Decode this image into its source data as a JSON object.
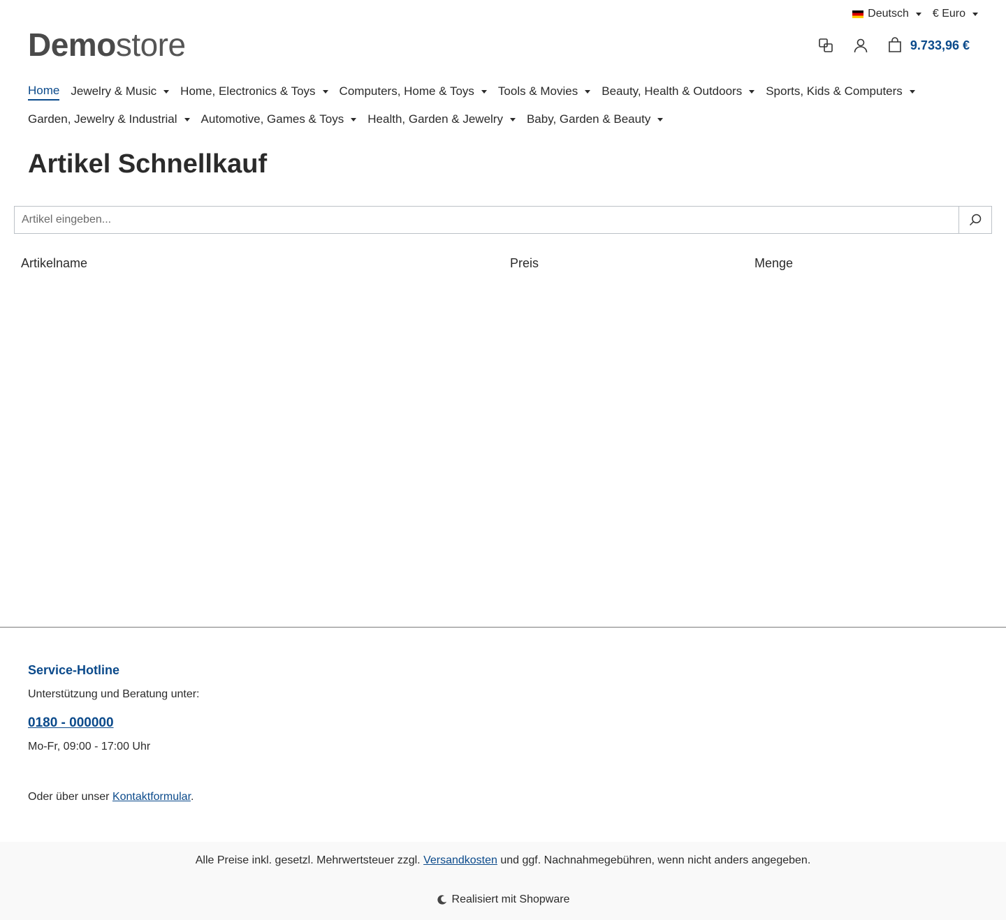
{
  "topbar": {
    "language": "Deutsch",
    "currency": "€ Euro"
  },
  "logo": {
    "bold": "Demo",
    "light": "store"
  },
  "header": {
    "cart_total": "9.733,96 €"
  },
  "nav": {
    "items": [
      {
        "label": "Home"
      },
      {
        "label": "Jewelry & Music"
      },
      {
        "label": "Home, Electronics & Toys"
      },
      {
        "label": "Computers, Home & Toys"
      },
      {
        "label": "Tools & Movies"
      },
      {
        "label": "Beauty, Health & Outdoors"
      },
      {
        "label": "Sports, Kids & Computers"
      },
      {
        "label": "Garden, Jewelry & Industrial"
      },
      {
        "label": "Automotive, Games & Toys"
      },
      {
        "label": "Health, Garden & Jewelry"
      },
      {
        "label": "Baby, Garden & Beauty"
      }
    ]
  },
  "page": {
    "title": "Artikel Schnellkauf"
  },
  "search": {
    "placeholder": "Artikel eingeben..."
  },
  "table": {
    "columns": [
      "Artikelname",
      "Preis",
      "Menge"
    ]
  },
  "footer": {
    "hotline_title": "Service-Hotline",
    "support_text": "Unterstützung und Beratung unter:",
    "phone": "0180 - 000000",
    "hours": "Mo-Fr, 09:00 - 17:00 Uhr",
    "contact_prefix": "Oder über unser ",
    "contact_link": "Kontaktformular",
    "contact_suffix": ".",
    "vat_prefix": "Alle Preise inkl. gesetzl. Mehrwertsteuer zzgl. ",
    "vat_link": "Versandkosten",
    "vat_suffix": " und ggf. Nachnahmegebühren, wenn nicht anders angegeben.",
    "powered": "Realisiert mit Shopware"
  },
  "colors": {
    "accent": "#0b4a8b",
    "text": "#2b2b2b",
    "footer_bg": "#f9f9f9"
  }
}
